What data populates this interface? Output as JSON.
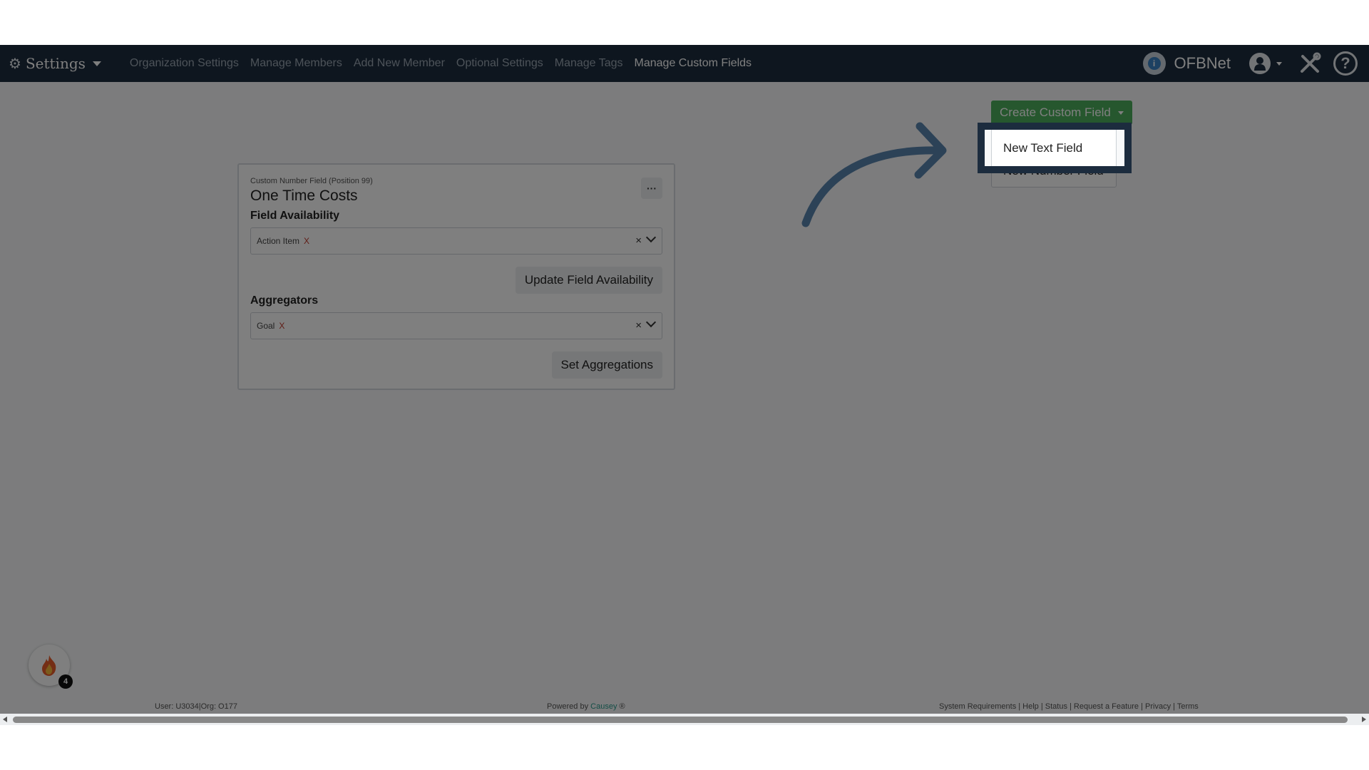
{
  "navbar": {
    "brand_label": "Settings",
    "links": [
      {
        "label": "Organization Settings",
        "active": false
      },
      {
        "label": "Manage Members",
        "active": false
      },
      {
        "label": "Add New Member",
        "active": false
      },
      {
        "label": "Optional Settings",
        "active": false
      },
      {
        "label": "Manage Tags",
        "active": false
      },
      {
        "label": "Manage Custom Fields",
        "active": true
      }
    ],
    "org_name": "OFBNet",
    "icons": {
      "brand": "gears-icon",
      "org": "info-icon",
      "user": "user-avatar-icon",
      "tools": "tools-icon",
      "help": "help-icon"
    }
  },
  "card": {
    "subtitle": "Custom Number Field (Position 99)",
    "title": "One Time Costs",
    "more_label": "···",
    "field_availability": {
      "label": "Field Availability",
      "tag": "Action Item",
      "tag_remove": "X",
      "clear": "×",
      "button": "Update Field Availability"
    },
    "aggregators": {
      "label": "Aggregators",
      "tag": "Goal",
      "tag_remove": "X",
      "clear": "×",
      "button": "Set Aggregations"
    }
  },
  "create_menu": {
    "button_label": "Create Custom Field",
    "items": [
      "New Text Field",
      "New Number Field"
    ]
  },
  "footer": {
    "left": "User: U3034|Org: O177",
    "powered_prefix": "Powered by ",
    "powered_brand": "Causey",
    "powered_suffix": " ®",
    "right": "System Requirements | Help | Status | Request a Feature | Privacy | Terms"
  },
  "fire_badge": {
    "count": "4",
    "icon": "fire-icon"
  },
  "colors": {
    "navbar": "#1c2c3e",
    "create_button": "#4cae5c",
    "highlight": "#1c2c3e",
    "arrow": "#2c4257"
  }
}
